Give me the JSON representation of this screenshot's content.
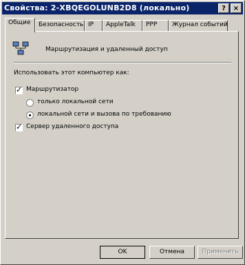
{
  "window": {
    "title": "Свойства: 2-XBQEGOLUNB2D8 (локально)",
    "help_button": "?",
    "close_button": "×"
  },
  "tabs": [
    {
      "label": "Общие",
      "active": true
    },
    {
      "label": "Безопасность"
    },
    {
      "label": "IP"
    },
    {
      "label": "AppleTalk"
    },
    {
      "label": "PPP"
    },
    {
      "label": "Журнал событий"
    }
  ],
  "general": {
    "service_name": "Маршрутизация и удаленный доступ",
    "use_as_label": "Использовать этот компьютер как:",
    "router_label": "Маршрутизатор",
    "router_checked": true,
    "lan_only_label": "только локальной сети",
    "lan_and_demand_label": "локальной сети и вызова по требованию",
    "selected_option": "lan_and_demand",
    "ras_label": "Сервер удаленного доступа",
    "ras_checked": true
  },
  "buttons": {
    "ok": "OK",
    "cancel": "Отмена",
    "apply": "Применить"
  }
}
